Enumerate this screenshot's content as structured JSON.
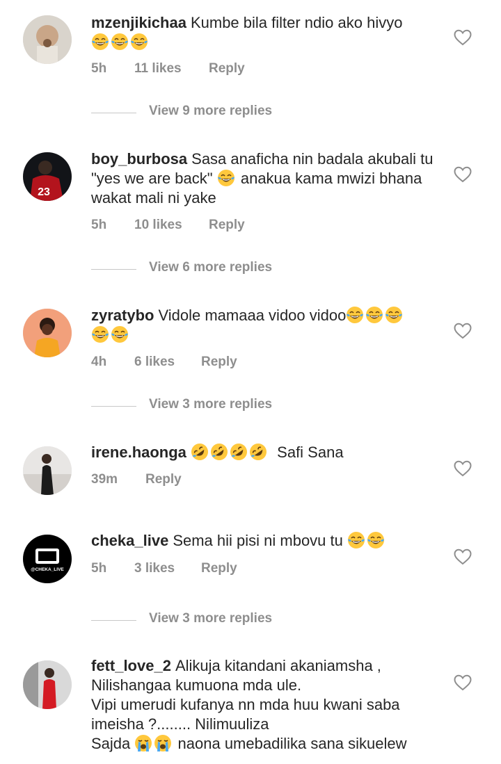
{
  "comments": [
    {
      "username": "mzenjikichaa",
      "text": "Kumbe bila filter ndio ako hivyo",
      "emoji_after": "😂😂😂",
      "time": "5h",
      "likes": "11 likes",
      "reply": "Reply",
      "view_more": "View 9 more replies"
    },
    {
      "username": "boy_burbosa",
      "text": "Sasa anaficha nin badala akubali tu \"yes we are back\"",
      "emoji_mid": "😂",
      "text_after": "anakua kama mwizi bhana wakat mali ni yake",
      "time": "5h",
      "likes": "10 likes",
      "reply": "Reply",
      "view_more": "View 6 more replies"
    },
    {
      "username": "zyratybo",
      "text": "Vidole mamaaa vidoo vidoo",
      "emoji_after": "😂😂😂😂😂",
      "time": "4h",
      "likes": "6 likes",
      "reply": "Reply",
      "view_more": "View 3 more replies"
    },
    {
      "username": "irene.haonga",
      "emoji_lead": "🤣🤣🤣🤣",
      "text": "Safi Sana",
      "time": "39m",
      "reply": "Reply"
    },
    {
      "username": "cheka_live",
      "text": "Sema hii pisi ni mbovu tu",
      "emoji_after": "😂😂",
      "time": "5h",
      "likes": "3 likes",
      "reply": "Reply",
      "view_more": "View 3 more replies",
      "avatar_text": "@CHEKA_LIVE"
    },
    {
      "username": "fett_love_2",
      "line1": "Alikuja kitandani akaniamsha ,",
      "line2": "Nilishangaa kumuona mda ule.",
      "line3": "Vipi umerudi kufanya nn mda huu kwani saba imeisha ?........ Nilimuuliza",
      "line4_a": "Sajda",
      "emoji_mid": "😭😭",
      "line4_b": "naona umebadilika sana sikuelew"
    }
  ],
  "icons": {
    "like": "heart-outline-icon",
    "laugh": "face-with-tears-of-joy",
    "rofl": "rolling-on-floor-laughing",
    "cry": "loudly-crying-face"
  },
  "colors": {
    "text": "#262626",
    "muted": "#8e8e8e",
    "divider": "#c7c7c7"
  }
}
